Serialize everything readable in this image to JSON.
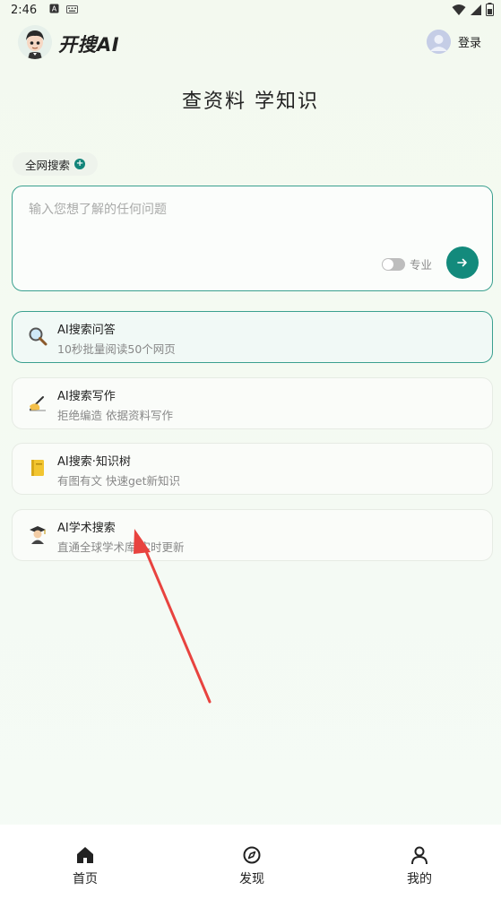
{
  "status_bar": {
    "time": "2:46",
    "icons": [
      "notification-a-icon",
      "keyboard-icon",
      "wifi-icon",
      "signal-icon",
      "battery-icon"
    ]
  },
  "header": {
    "brand": "开搜AI",
    "login": "登录"
  },
  "hero": {
    "title": "查资料 学知识"
  },
  "scope_chip": {
    "label": "全网搜索"
  },
  "search": {
    "placeholder": "输入您想了解的任何问题",
    "value": "",
    "pro_label": "专业",
    "pro_enabled": false
  },
  "cards": [
    {
      "icon": "magnifier-emoji",
      "title": "AI搜索问答",
      "subtitle": "10秒批量阅读50个网页",
      "active": true
    },
    {
      "icon": "writing-hand-emoji",
      "title": "AI搜索写作",
      "subtitle": "拒绝编造 依据资料写作",
      "active": false
    },
    {
      "icon": "notebook-emoji",
      "title": "AI搜索·知识树",
      "subtitle": "有图有文 快速get新知识",
      "active": false
    },
    {
      "icon": "student-emoji",
      "title": "AI学术搜索",
      "subtitle": "直通全球学术库 实时更新",
      "active": false
    }
  ],
  "nav": {
    "home": "首页",
    "discover": "发现",
    "mine": "我的"
  },
  "colors": {
    "accent": "#138a7c",
    "border_active": "#3aa08f",
    "annotation_arrow": "#e8433f"
  }
}
